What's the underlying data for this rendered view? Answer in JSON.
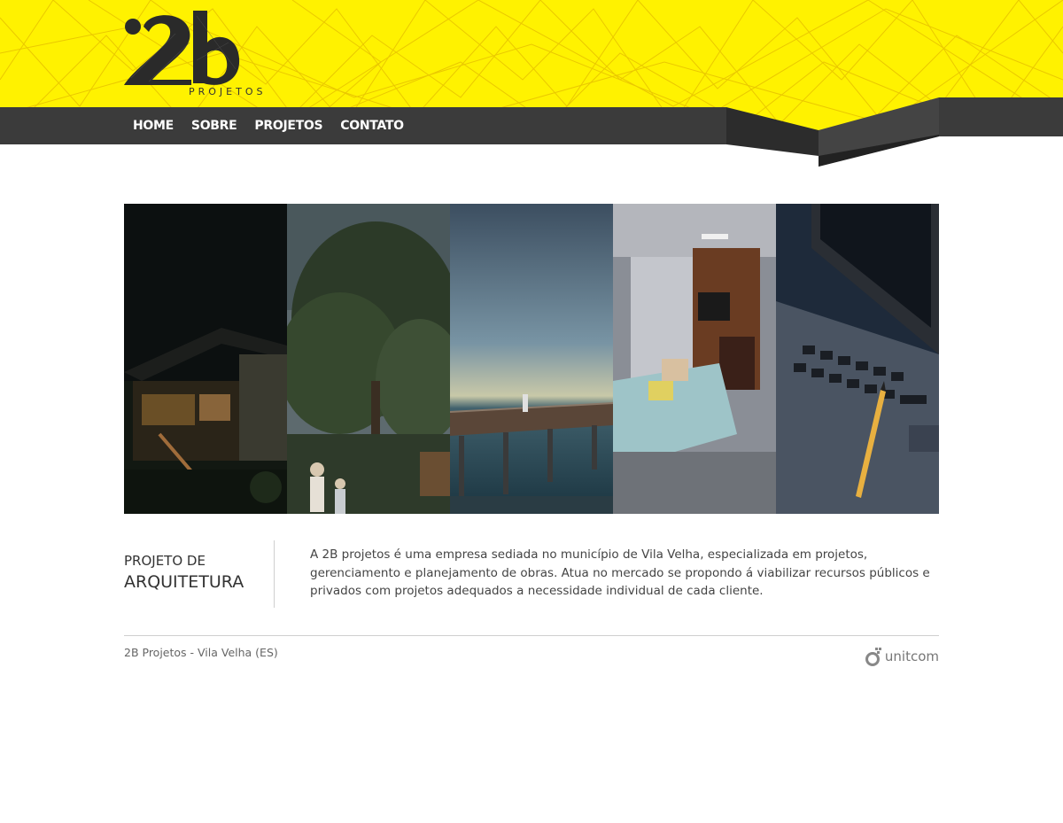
{
  "brand": {
    "logo_mark": "2b",
    "logo_sub": "PROJETOS",
    "accent_color": "#fff200",
    "nav_color": "#3b3b3b"
  },
  "nav": {
    "items": [
      {
        "label": "HOME"
      },
      {
        "label": "SOBRE"
      },
      {
        "label": "PROJETOS"
      },
      {
        "label": "CONTATO"
      }
    ]
  },
  "gallery": {
    "panels": [
      {
        "icon": "house-night-render-image"
      },
      {
        "icon": "garden-trees-render-image"
      },
      {
        "icon": "pier-sea-render-image"
      },
      {
        "icon": "living-room-render-image"
      },
      {
        "icon": "laptop-pencil-image"
      }
    ]
  },
  "content": {
    "headline_small": "PROJETO DE",
    "headline_big": "ARQUITETURA",
    "description": "A 2B projetos é uma empresa sediada no município de Vila Velha, especializada em projetos, gerenciamento e planejamento de obras. Atua no mercado se propondo á viabilizar recursos públicos e privados com projetos adequados a necessidade individual de cada cliente."
  },
  "footer": {
    "text": "2B Projetos - Vila Velha (ES)",
    "credit": "unitcom"
  }
}
